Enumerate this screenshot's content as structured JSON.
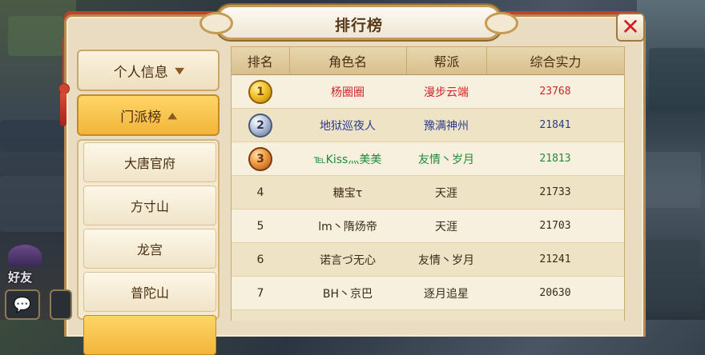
{
  "window": {
    "title": "排行榜",
    "close_icon": "✕"
  },
  "hud": {
    "friend_label": "好友",
    "chat_icon": "chat-bubble-icon"
  },
  "menu": {
    "personal_info": "个人信息",
    "sect_rank": "门派榜",
    "sects": [
      "大唐官府",
      "方寸山",
      "龙宫",
      "普陀山"
    ]
  },
  "table": {
    "headers": [
      "排名",
      "角色名",
      "帮派",
      "综合实力"
    ],
    "rows": [
      {
        "rank": "1",
        "name": "杨圈圈",
        "guild": "漫步云端",
        "power": "23768"
      },
      {
        "rank": "2",
        "name": "地狱巡夜人",
        "guild": "豫满神州",
        "power": "21841"
      },
      {
        "rank": "3",
        "name": "℡Kiss灬美美",
        "guild": "友情丶岁月",
        "power": "21813"
      },
      {
        "rank": "4",
        "name": "糖宝τ",
        "guild": "天涯",
        "power": "21733"
      },
      {
        "rank": "5",
        "name": "lm丶隋炀帝",
        "guild": "天涯",
        "power": "21703"
      },
      {
        "rank": "6",
        "name": "诺言づ无心",
        "guild": "友情丶岁月",
        "power": "21241"
      },
      {
        "rank": "7",
        "name": "BH丶京巴",
        "guild": "逐月追星",
        "power": "20630"
      }
    ]
  },
  "colors": {
    "rank1": "#d0242a",
    "rank2": "#2a3b8f",
    "rank3": "#1f8a3a",
    "default": "#3a2a18"
  }
}
